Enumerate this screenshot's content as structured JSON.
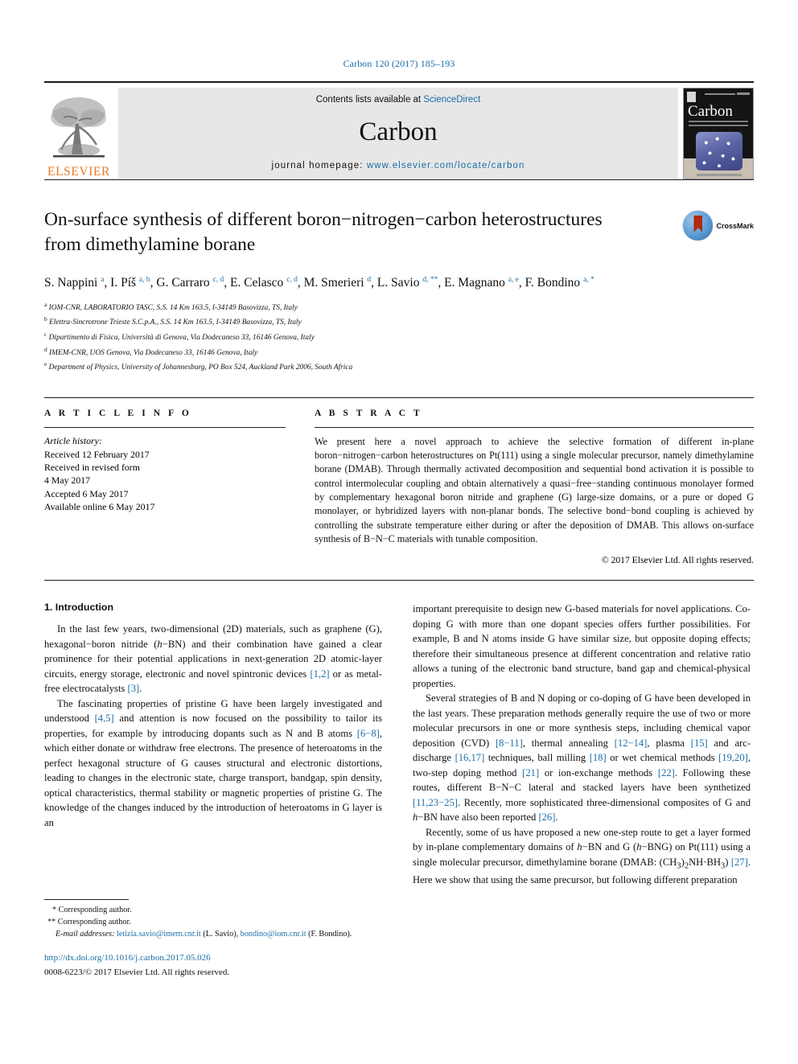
{
  "running_head": "Carbon 120 (2017) 185–193",
  "masthead": {
    "contents_prefix": "Contents lists available at ",
    "contents_link": "ScienceDirect",
    "journal_title": "Carbon",
    "homepage_prefix": "journal homepage: ",
    "homepage_url": "www.elsevier.com/locate/carbon",
    "publisher_name": "ELSEVIER",
    "cover_title": "Carbon",
    "colors": {
      "link_blue": "#1a6ea8",
      "elsevier_orange": "#E87722",
      "band_gray": "#e7e7e7"
    }
  },
  "crossmark": {
    "label": "CrossMark"
  },
  "article": {
    "title": "On-surface synthesis of different boron−nitrogen−carbon heterostructures from dimethylamine borane",
    "authors_html": "S. Nappini <sup>a</sup>, I. Píš <sup>a, b</sup>, G. Carraro <sup>c, d</sup>, E. Celasco <sup>c, d</sup>, M. Smerieri <sup>d</sup>, L. Savio <sup>d, **</sup>, E. Magnano <sup>a, e</sup>, F. Bondino <sup>a, *</sup>",
    "affiliations": [
      {
        "mark": "a",
        "text": "IOM-CNR, LABORATORIO TASC, S.S. 14 Km 163.5, I-34149 Basovizza, TS, Italy"
      },
      {
        "mark": "b",
        "text": "Elettra-Sincrotrone Trieste S.C.p.A., S.S. 14 Km 163.5, I-34149 Basovizza, TS, Italy"
      },
      {
        "mark": "c",
        "text": "Dipartimento di Fisica, Università di Genova, Via Dodecaneso 33, 16146 Genova, Italy"
      },
      {
        "mark": "d",
        "text": "IMEM-CNR, UOS Genova, Via Dodecaneso 33, 16146 Genova, Italy"
      },
      {
        "mark": "e",
        "text": "Department of Physics, University of Johannesburg, PO Box 524, Auckland Park 2006, South Africa"
      }
    ]
  },
  "article_info": {
    "heading": "A R T I C L E   I N F O",
    "history_label": "Article history:",
    "history_lines": [
      "Received 12 February 2017",
      "Received in revised form",
      "4 May 2017",
      "Accepted 6 May 2017",
      "Available online 6 May 2017"
    ]
  },
  "abstract": {
    "heading": "A B S T R A C T",
    "text": "We present here a novel approach to achieve the selective formation of different in-plane boron−nitrogen−carbon heterostructures on Pt(111) using a single molecular precursor, namely dimethylamine borane (DMAB). Through thermally activated decomposition and sequential bond activation it is possible to control intermolecular coupling and obtain alternatively a quasi−free−standing continuous monolayer formed by complementary hexagonal boron nitride and graphene (G) large-size domains, or a pure or doped G monolayer, or hybridized layers with non-planar bonds. The selective bond−bond coupling is achieved by controlling the substrate temperature either during or after the deposition of DMAB. This allows on-surface synthesis of B−N−C materials with tunable composition.",
    "copyright": "© 2017 Elsevier Ltd. All rights reserved."
  },
  "introduction": {
    "section_number_title": "1. Introduction",
    "left_paragraphs": [
      "In the last few years, two-dimensional (2D) materials, such as graphene (G), hexagonal−boron nitride (h−BN) and their combination have gained a clear prominence for their potential applications in next-generation 2D atomic-layer circuits, energy storage, electronic and novel spintronic devices [1,2] or as metal-free electrocatalysts [3].",
      "The fascinating properties of pristine G have been largely investigated and understood [4,5] and attention is now focused on the possibility to tailor its properties, for example by introducing dopants such as N and B atoms [6−8], which either donate or withdraw free electrons. The presence of heteroatoms in the perfect hexagonal structure of G causes structural and electronic distortions, leading to changes in the electronic state, charge transport, bandgap, spin density, optical characteristics, thermal stability or magnetic properties of pristine G. The knowledge of the changes induced by the introduction of heteroatoms in G layer is an"
    ],
    "right_paragraphs": [
      "important prerequisite to design new G-based materials for novel applications. Co-doping G with more than one dopant species offers further possibilities. For example, B and N atoms inside G have similar size, but opposite doping effects; therefore their simultaneous presence at different concentration and relative ratio allows a tuning of the electronic band structure, band gap and chemical-physical properties.",
      "Several strategies of B and N doping or co-doping of G have been developed in the last years. These preparation methods generally require the use of two or more molecular precursors in one or more synthesis steps, including chemical vapor deposition (CVD) [8−11], thermal annealing [12−14], plasma [15] and arc-discharge [16,17] techniques, ball milling [18] or wet chemical methods [19,20], two-step doping method [21] or ion-exchange methods [22]. Following these routes, different B−N−C lateral and stacked layers have been synthetized [11,23−25]. Recently, more sophisticated three-dimensional composites of G and h−BN have also been reported [26].",
      "Recently, some of us have proposed a new one-step route to get a layer formed by in-plane complementary domains of h−BN and G (h−BNG) on Pt(111) using a single molecular precursor, dimethylamine borane (DMAB: (CH3)2NH·BH3) [27]. Here we show that using the same precursor, but following different preparation"
    ]
  },
  "footnotes": {
    "corresponding_1": "* Corresponding author.",
    "corresponding_2": "** Corresponding author.",
    "email_label": "E-mail addresses:",
    "email_1": "letizia.savio@imem.cnr.it",
    "email_1_owner": "(L. Savio),",
    "email_2": "bondino@iom.cnr.it",
    "email_2_owner": "(F. Bondino).",
    "doi_url": "http://dx.doi.org/10.1016/j.carbon.2017.05.026",
    "issn_line": "0008-6223/© 2017 Elsevier Ltd. All rights reserved."
  }
}
